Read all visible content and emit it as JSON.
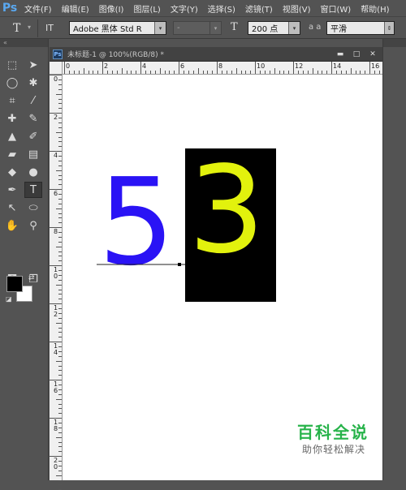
{
  "app": {
    "logo": "Ps"
  },
  "menu": [
    "文件(F)",
    "编辑(E)",
    "图像(I)",
    "图层(L)",
    "文字(Y)",
    "选择(S)",
    "滤镜(T)",
    "视图(V)",
    "窗口(W)",
    "帮助(H)"
  ],
  "options_bar": {
    "tool_icon": "T",
    "orient_icon": "IT",
    "font_family": "Adobe 黑体 Std R",
    "font_style": "-",
    "size_icon": "T",
    "font_size": "200 点",
    "aa_icon": "a a",
    "antialias": "平滑"
  },
  "document": {
    "tab_title": "未标题-1 @ 100%(RGB/8) *",
    "ruler_h": [
      "0",
      "2",
      "4",
      "6",
      "8",
      "10",
      "12",
      "14",
      "16"
    ],
    "ruler_v": [
      "0",
      "2",
      "4",
      "6",
      "8",
      "1 0",
      "1 2",
      "1 4",
      "1 6",
      "1 8",
      "2 0"
    ]
  },
  "canvas": {
    "digit_left": "5",
    "digit_left_color": "#2a13f5",
    "digit_right": "3",
    "digit_right_color": "#e2f20d",
    "box_color": "#000000"
  },
  "colors": {
    "foreground": "#000000",
    "background": "#ffffff"
  },
  "watermark": {
    "title": "百科全说",
    "subtitle": "助你轻松解决"
  }
}
